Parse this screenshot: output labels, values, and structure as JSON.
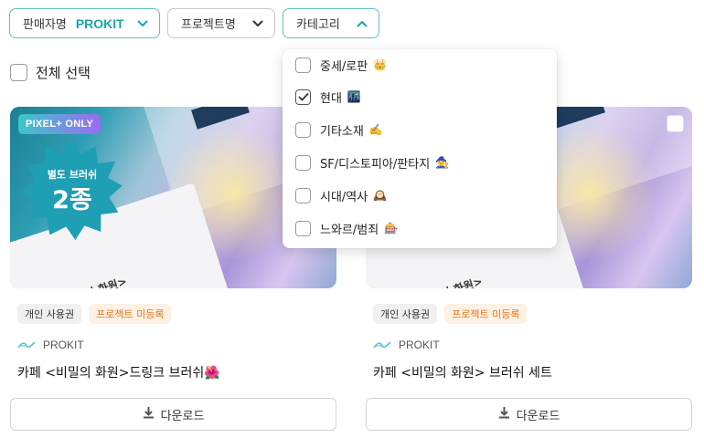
{
  "filters": {
    "seller_label": "판매자명",
    "seller_value": "PROKIT",
    "project_label": "프로젝트명",
    "category_label": "카테고리"
  },
  "select_all_label": "전체 선택",
  "category_dropdown": {
    "items": [
      {
        "label": "중세/로판",
        "emoji": "👑",
        "checked": false
      },
      {
        "label": "현대",
        "emoji": "🌃",
        "checked": true
      },
      {
        "label": "기타소재",
        "emoji": "✍️",
        "checked": false
      },
      {
        "label": "SF/디스토피아/판타지",
        "emoji": "🧙",
        "checked": false
      },
      {
        "label": "시대/역사",
        "emoji": "🕰️",
        "checked": false
      },
      {
        "label": "느와르/범죄",
        "emoji": "🎰",
        "checked": false
      }
    ]
  },
  "products": [
    {
      "badge": "PIXEL+ ONLY",
      "promo_line1": "별도 브러쉬",
      "promo_line2": "2종",
      "thumb_text": "카페 <비밀의 화원>",
      "license": "개인 사용권",
      "status": "프로젝트 미등록",
      "seller": "PROKIT",
      "title": "카페 <비밀의 화원>드링크 브러쉬",
      "title_emoji": "🌺",
      "download_label": "다운로드"
    },
    {
      "thumb_text": "카페 <비밀의 화원>",
      "license": "개인 사용권",
      "status": "프로젝트 미등록",
      "seller": "PROKIT",
      "title": "카페 <비밀의 화원> 브러쉬 세트",
      "download_label": "다운로드"
    }
  ],
  "colors": {
    "accent": "#1aa6a6",
    "status_text": "#e07820",
    "status_bg": "#fdf1e4"
  },
  "icons": [
    "chevron-down-icon",
    "chevron-up-icon",
    "checkmark-icon",
    "download-icon",
    "prokit-logo-icon"
  ]
}
